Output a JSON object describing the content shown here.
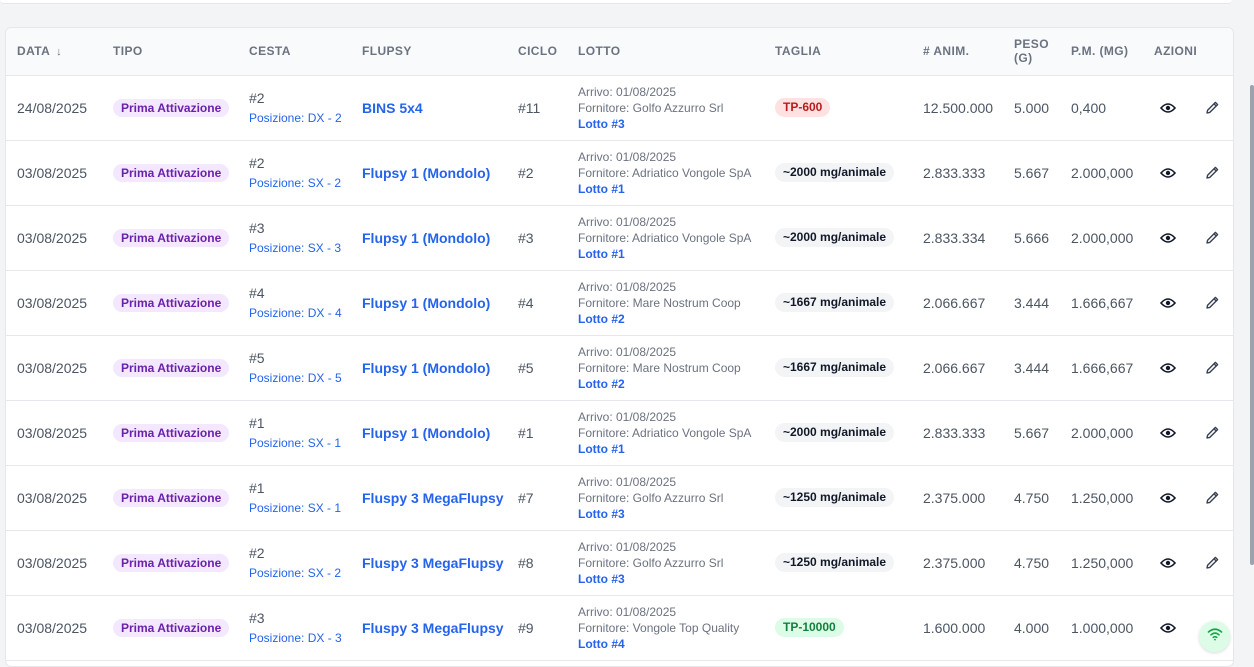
{
  "headers": {
    "data": "DATA",
    "tipo": "TIPO",
    "cesta": "CESTA",
    "flupsy": "FLUPSY",
    "ciclo": "CICLO",
    "lotto": "LOTTO",
    "taglia": "TAGLIA",
    "anim": "# ANIM.",
    "peso": "PESO (G)",
    "pm": "P.M. (MG)",
    "azioni": "AZIONI",
    "sort_icon": "↓"
  },
  "rows": [
    {
      "data": "24/08/2025",
      "tipo": "Prima Attivazione",
      "cesta_num": "#2",
      "cesta_pos": "Posizione: DX - 2",
      "flupsy": "BINS 5x4",
      "ciclo": "#11",
      "arrivo": "Arrivo: 01/08/2025",
      "fornitore": "Fornitore: Golfo Azzurro Srl",
      "lotto": "Lotto #3",
      "taglia": "TP-600",
      "taglia_style": "red",
      "anim": "12.500.000",
      "peso": "5.000",
      "pm": "0,400"
    },
    {
      "data": "03/08/2025",
      "tipo": "Prima Attivazione",
      "cesta_num": "#2",
      "cesta_pos": "Posizione: SX - 2",
      "flupsy": "Flupsy 1 (Mondolo)",
      "ciclo": "#2",
      "arrivo": "Arrivo: 01/08/2025",
      "fornitore": "Fornitore: Adriatico Vongole SpA",
      "lotto": "Lotto #1",
      "taglia": "~2000 mg/animale",
      "taglia_style": "gray",
      "anim": "2.833.333",
      "peso": "5.667",
      "pm": "2.000,000"
    },
    {
      "data": "03/08/2025",
      "tipo": "Prima Attivazione",
      "cesta_num": "#3",
      "cesta_pos": "Posizione: SX - 3",
      "flupsy": "Flupsy 1 (Mondolo)",
      "ciclo": "#3",
      "arrivo": "Arrivo: 01/08/2025",
      "fornitore": "Fornitore: Adriatico Vongole SpA",
      "lotto": "Lotto #1",
      "taglia": "~2000 mg/animale",
      "taglia_style": "gray",
      "anim": "2.833.334",
      "peso": "5.666",
      "pm": "2.000,000"
    },
    {
      "data": "03/08/2025",
      "tipo": "Prima Attivazione",
      "cesta_num": "#4",
      "cesta_pos": "Posizione: DX - 4",
      "flupsy": "Flupsy 1 (Mondolo)",
      "ciclo": "#4",
      "arrivo": "Arrivo: 01/08/2025",
      "fornitore": "Fornitore: Mare Nostrum Coop",
      "lotto": "Lotto #2",
      "taglia": "~1667 mg/animale",
      "taglia_style": "gray",
      "anim": "2.066.667",
      "peso": "3.444",
      "pm": "1.666,667"
    },
    {
      "data": "03/08/2025",
      "tipo": "Prima Attivazione",
      "cesta_num": "#5",
      "cesta_pos": "Posizione: DX - 5",
      "flupsy": "Flupsy 1 (Mondolo)",
      "ciclo": "#5",
      "arrivo": "Arrivo: 01/08/2025",
      "fornitore": "Fornitore: Mare Nostrum Coop",
      "lotto": "Lotto #2",
      "taglia": "~1667 mg/animale",
      "taglia_style": "gray",
      "anim": "2.066.667",
      "peso": "3.444",
      "pm": "1.666,667"
    },
    {
      "data": "03/08/2025",
      "tipo": "Prima Attivazione",
      "cesta_num": "#1",
      "cesta_pos": "Posizione: SX - 1",
      "flupsy": "Flupsy 1 (Mondolo)",
      "ciclo": "#1",
      "arrivo": "Arrivo: 01/08/2025",
      "fornitore": "Fornitore: Adriatico Vongole SpA",
      "lotto": "Lotto #1",
      "taglia": "~2000 mg/animale",
      "taglia_style": "gray",
      "anim": "2.833.333",
      "peso": "5.667",
      "pm": "2.000,000"
    },
    {
      "data": "03/08/2025",
      "tipo": "Prima Attivazione",
      "cesta_num": "#1",
      "cesta_pos": "Posizione: SX - 1",
      "flupsy": "Fluspy 3 MegaFlupsy",
      "ciclo": "#7",
      "arrivo": "Arrivo: 01/08/2025",
      "fornitore": "Fornitore: Golfo Azzurro Srl",
      "lotto": "Lotto #3",
      "taglia": "~1250 mg/animale",
      "taglia_style": "gray",
      "anim": "2.375.000",
      "peso": "4.750",
      "pm": "1.250,000"
    },
    {
      "data": "03/08/2025",
      "tipo": "Prima Attivazione",
      "cesta_num": "#2",
      "cesta_pos": "Posizione: SX - 2",
      "flupsy": "Fluspy 3 MegaFlupsy",
      "ciclo": "#8",
      "arrivo": "Arrivo: 01/08/2025",
      "fornitore": "Fornitore: Golfo Azzurro Srl",
      "lotto": "Lotto #3",
      "taglia": "~1250 mg/animale",
      "taglia_style": "gray",
      "anim": "2.375.000",
      "peso": "4.750",
      "pm": "1.250,000"
    },
    {
      "data": "03/08/2025",
      "tipo": "Prima Attivazione",
      "cesta_num": "#3",
      "cesta_pos": "Posizione: DX - 3",
      "flupsy": "Fluspy 3 MegaFlupsy",
      "ciclo": "#9",
      "arrivo": "Arrivo: 01/08/2025",
      "fornitore": "Fornitore: Vongole Top Quality",
      "lotto": "Lotto #4",
      "taglia": "TP-10000",
      "taglia_style": "green",
      "anim": "1.600.000",
      "peso": "4.000",
      "pm": "1.000,000"
    }
  ],
  "icons": {
    "view": "eye-icon",
    "edit": "pencil-icon",
    "status": "wifi-icon"
  },
  "colors": {
    "link": "#2563eb",
    "badge_purple_bg": "#f3e8ff",
    "badge_purple_text": "#6b21a8",
    "status_green": "#16a34a"
  }
}
